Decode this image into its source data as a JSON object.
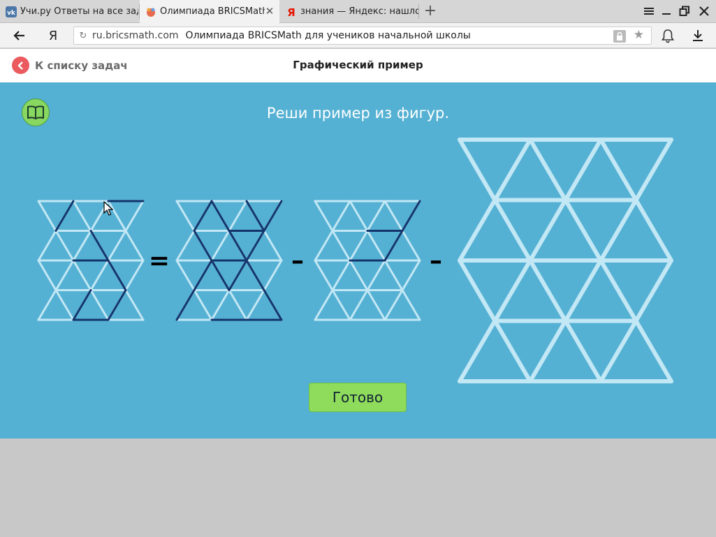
{
  "browser": {
    "tabs": [
      {
        "title": "Учи.ру Ответы на все задач",
        "favicon": "vk-icon",
        "active": false
      },
      {
        "title": "Олимпиада BRICSMath для",
        "favicon": "bricsmath-icon",
        "active": true
      },
      {
        "title": "знания — Яндекс: нашлось",
        "favicon": "yandex-icon",
        "active": false
      }
    ],
    "new_tab_label": "+",
    "address": {
      "domain": "ru.bricsmath.com",
      "page_title": "Олимпиада BRICSMath для учеников начальной школы"
    },
    "yandex_letter": "Я"
  },
  "header": {
    "back_label": "К списку задач",
    "title": "Графический пример"
  },
  "task": {
    "instruction": "Реши пример из фигур.",
    "equals_sign": "=",
    "minus_sign": "–",
    "done_label": "Готово",
    "colors": {
      "background": "#55b1d3",
      "light_stick": "#c2e7f5",
      "dark_stick": "#14356c",
      "button": "#8fdc5c"
    },
    "figures": [
      {
        "role": "operand-1",
        "dark_sticks": [
          [
            1,
            2,
            2,
            2
          ],
          [
            2,
            2,
            2.5,
            3
          ],
          [
            2.5,
            3,
            2,
            4
          ],
          [
            1.5,
            3,
            1,
            4
          ],
          [
            1,
            4,
            2,
            4
          ],
          [
            1.5,
            1,
            2,
            2
          ],
          [
            0.5,
            1,
            1,
            0
          ],
          [
            2,
            0,
            3,
            0
          ]
        ]
      },
      {
        "role": "result",
        "dark_sticks": [
          [
            1,
            4,
            3,
            4
          ],
          [
            3,
            4,
            2.5,
            3
          ],
          [
            0,
            4,
            0.5,
            3
          ],
          [
            0.5,
            3,
            1,
            2
          ],
          [
            1,
            2,
            2,
            2
          ],
          [
            2,
            2,
            1.5,
            1
          ],
          [
            1,
            2,
            0.5,
            1
          ],
          [
            0.5,
            1,
            1,
            0
          ],
          [
            1.5,
            1,
            2.5,
            1
          ],
          [
            1.5,
            1,
            1,
            0
          ],
          [
            2,
            2,
            2.5,
            1
          ],
          [
            2.5,
            1,
            2,
            0
          ],
          [
            2.5,
            1,
            3,
            0
          ],
          [
            2.5,
            3,
            2,
            2
          ],
          [
            1,
            2,
            1.5,
            3
          ],
          [
            1.5,
            3,
            2,
            2
          ]
        ]
      },
      {
        "role": "operand-2",
        "dark_sticks": [
          [
            1,
            2,
            2,
            2
          ],
          [
            2,
            2,
            2.5,
            1
          ],
          [
            2.5,
            1,
            3,
            0
          ],
          [
            1.5,
            1,
            2.5,
            1
          ]
        ]
      },
      {
        "role": "operand-3",
        "dark_sticks": []
      }
    ]
  }
}
